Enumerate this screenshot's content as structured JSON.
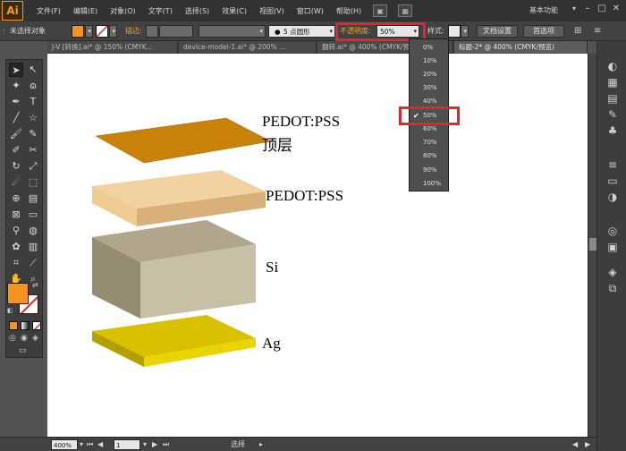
{
  "app": {
    "logo": "Ai"
  },
  "menubar": {
    "items": [
      "文件(F)",
      "编辑(E)",
      "对象(O)",
      "文字(T)",
      "选择(S)",
      "效果(C)",
      "视图(V)",
      "窗口(W)",
      "帮助(H)"
    ],
    "workspace": "基本功能"
  },
  "controlbar": {
    "selection": "未选择对象",
    "stroke_label": "描边:",
    "brush": "5 点圆形",
    "opacity_label": "不透明度:",
    "opacity_value": "50%",
    "style_label": "样式:",
    "doc_setup": "文档设置",
    "prefs": "首选项",
    "fill_color": "#f7941d"
  },
  "tabs": [
    "J-V [转换].ai* @ 150% (CMYK...",
    "device-model-1.ai* @ 200% ...",
    "翻转.ai* @ 400% (CMYK/预...",
    "标题-2* @ 400% (CMYK/预览)"
  ],
  "opacity_options": [
    "0%",
    "10%",
    "20%",
    "30%",
    "40%",
    "50%",
    "60%",
    "70%",
    "80%",
    "90%",
    "100%"
  ],
  "opacity_selected": "50%",
  "canvas": {
    "labels": [
      "PEDOT:PSS",
      "顶层",
      "PEDOT:PSS",
      "Si",
      "Ag"
    ],
    "colors": {
      "top_layer": "#c8820a",
      "pedot_top": "#f2d2a0",
      "pedot_front": "#efcb8f",
      "pedot_side": "#d9b07a",
      "si_top": "#b1a68d",
      "si_front": "#c7bfa6",
      "si_side": "#948b72",
      "ag_top": "#d9c100",
      "ag_front": "#ead400",
      "ag_side": "#b39f00"
    }
  },
  "statusbar": {
    "zoom": "400%",
    "page": "1",
    "mode": "选择"
  }
}
